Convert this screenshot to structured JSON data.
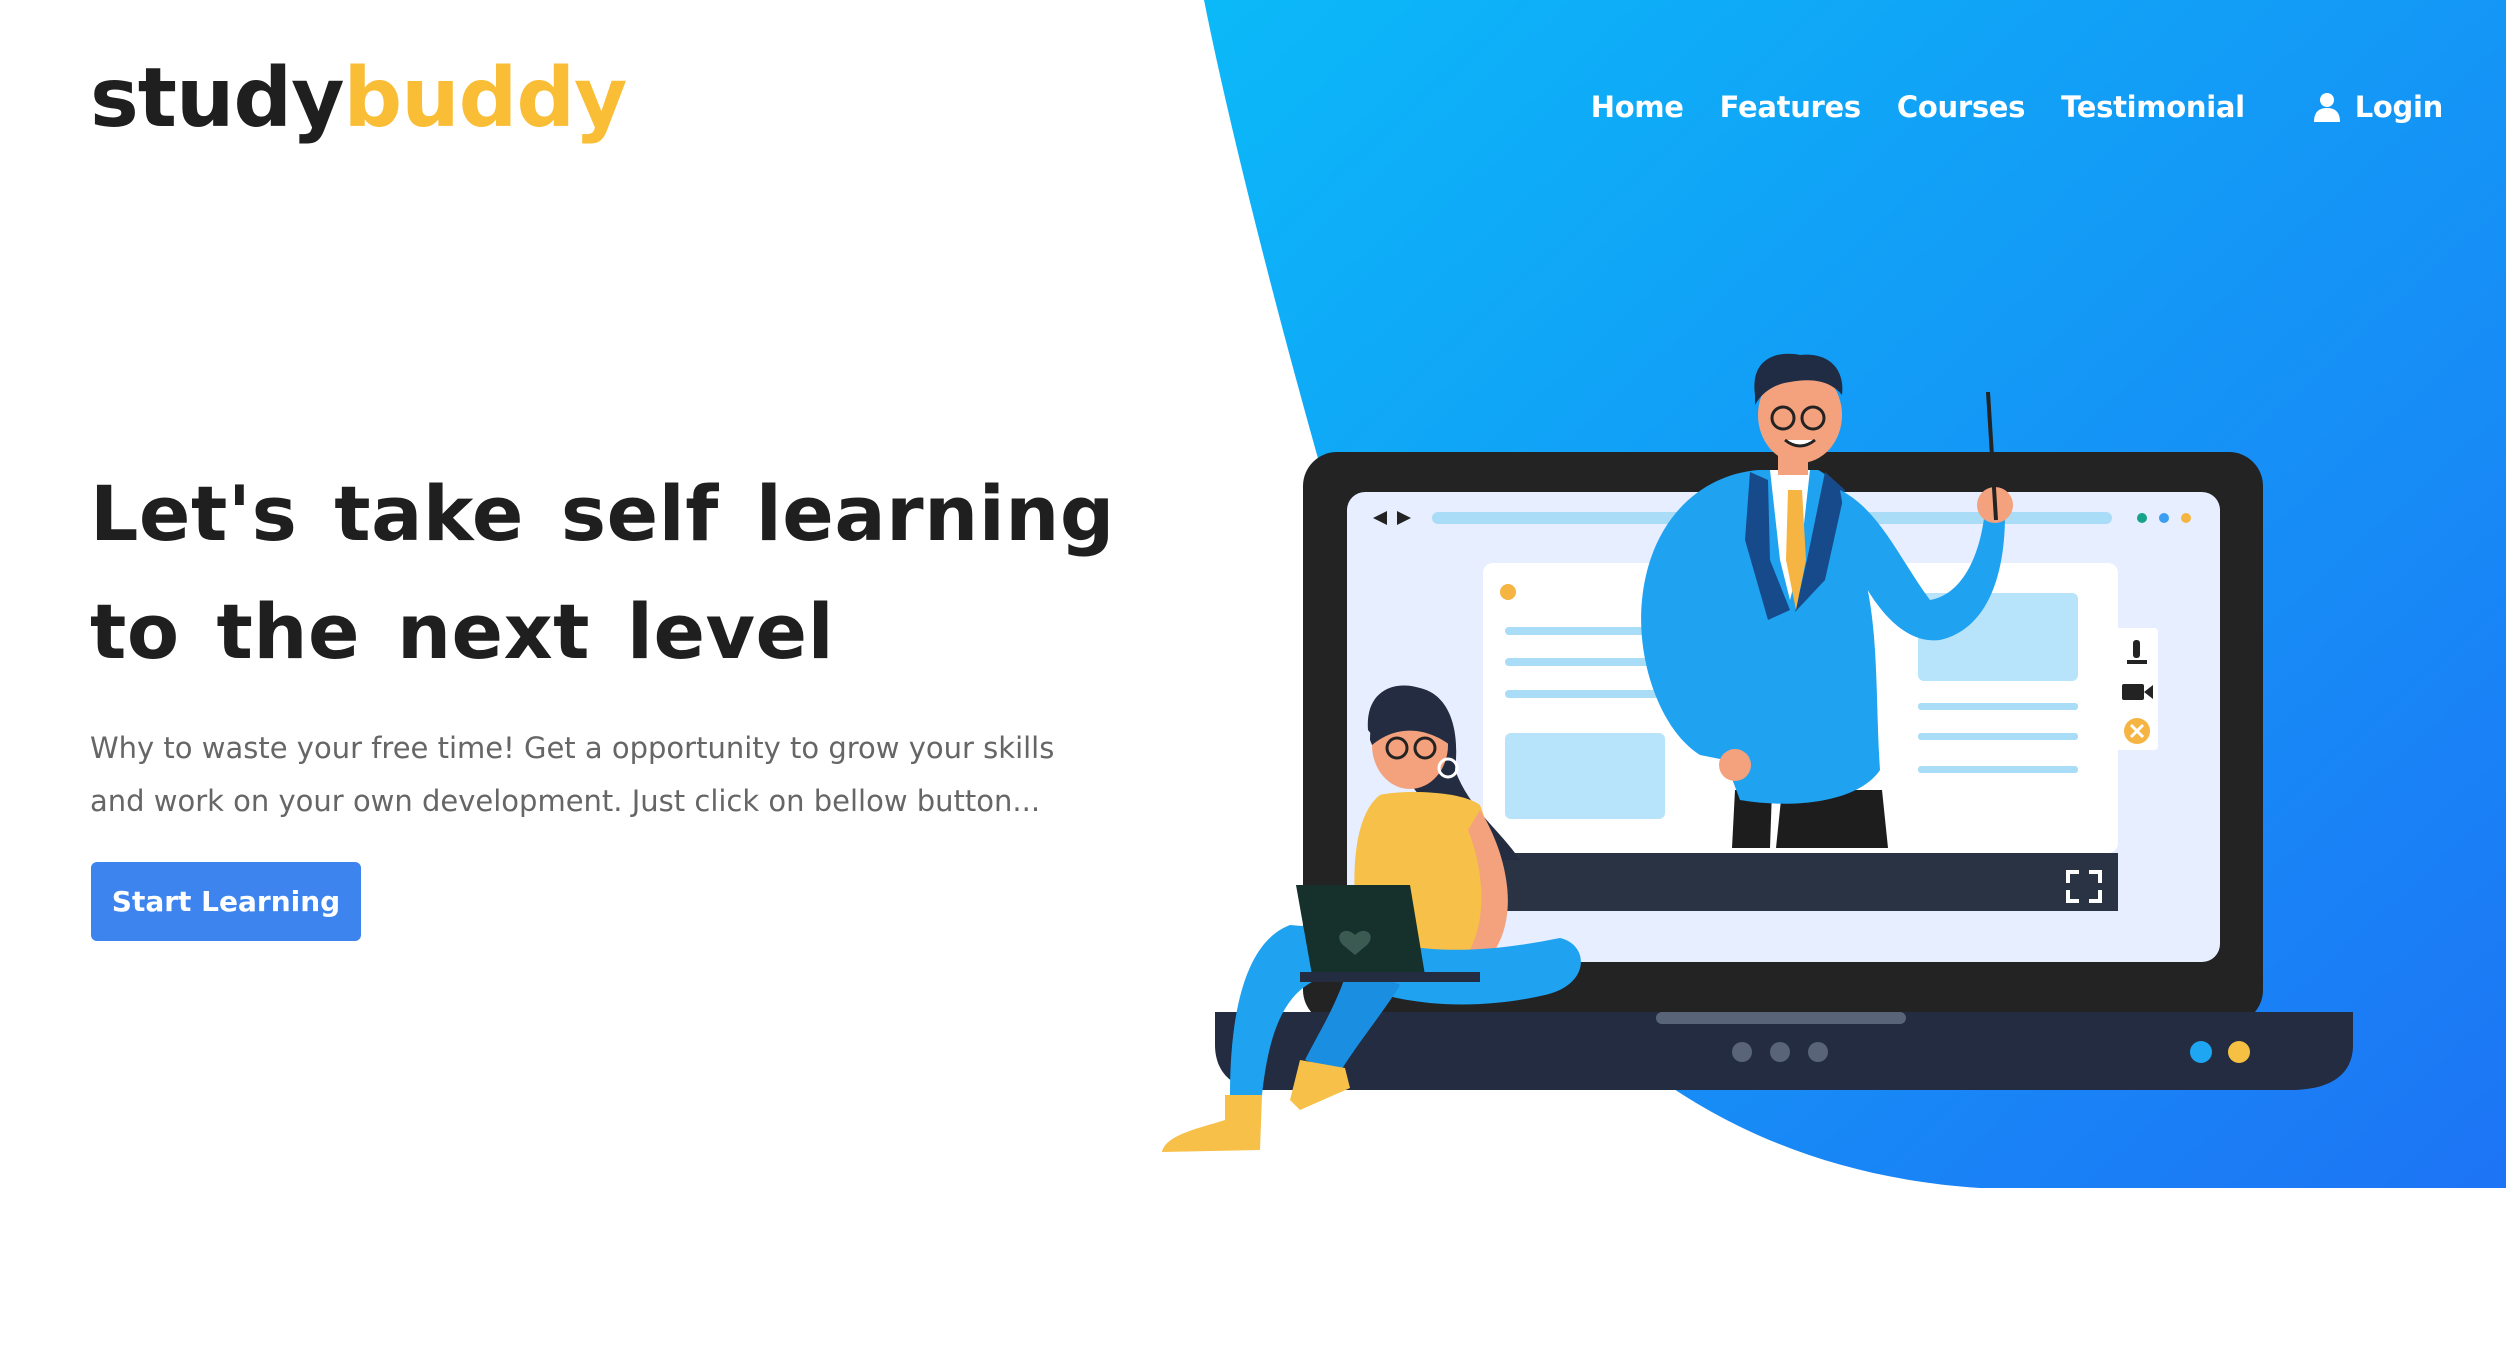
{
  "brand": {
    "part_a": "study",
    "part_b": "buddy"
  },
  "nav": {
    "items": [
      "Home",
      "Features",
      "Courses",
      "Testimonial"
    ],
    "login_label": "Login"
  },
  "hero": {
    "headline_line1": "Let's take self learning",
    "headline_line2": "to the next level",
    "description": "Why to waste your free time! Get a opportunity to grow your skills and work on your own development. Just click on bellow button...",
    "cta_label": "Start Learning"
  },
  "icons": {
    "user": "user-icon",
    "nav_arrows": "back-forward-icon",
    "microphone": "microphone-icon",
    "camera": "video-camera-icon",
    "close": "close-circle-icon",
    "fullscreen": "fullscreen-icon",
    "heart": "heart-icon"
  },
  "colors": {
    "brand_dark": "#1f1f1f",
    "brand_accent": "#f9bd36",
    "blue_light": "#0bb7f7",
    "blue_dark": "#1d78f5",
    "button": "#3d84ee",
    "text_muted": "#666666"
  }
}
